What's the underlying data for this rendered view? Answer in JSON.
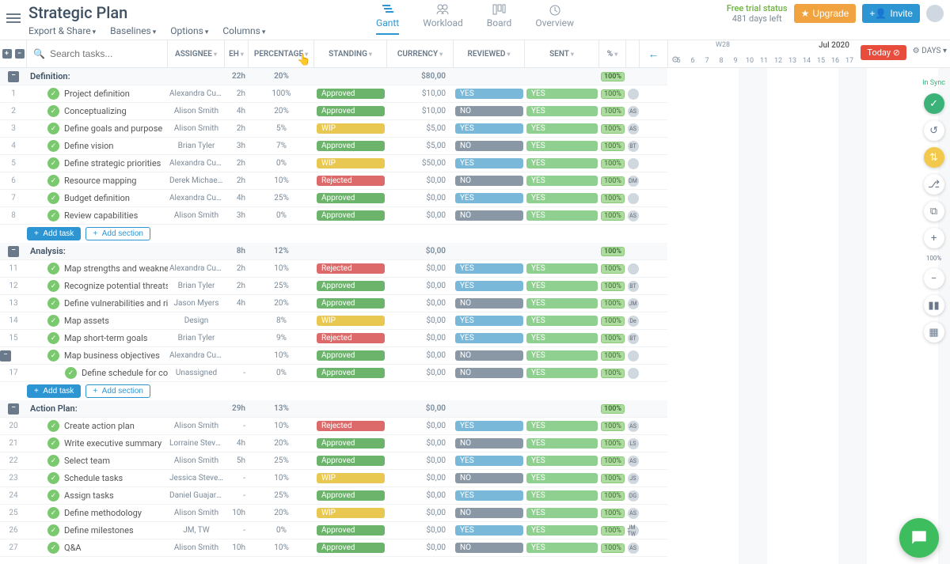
{
  "header": {
    "title": "Strategic Plan",
    "menu": [
      "Export & Share",
      "Baselines",
      "Options",
      "Columns"
    ],
    "views": [
      {
        "id": "gantt",
        "label": "Gantt",
        "active": true
      },
      {
        "id": "workload",
        "label": "Workload"
      },
      {
        "id": "board",
        "label": "Board"
      },
      {
        "id": "overview",
        "label": "Overview"
      }
    ],
    "trial_status": "Free trial status",
    "trial_days": "481 days left",
    "upgrade": "Upgrade",
    "invite": "Invite"
  },
  "toolbar": {
    "search_placeholder": "Search tasks...",
    "columns": [
      "ASSIGNEE",
      "EH",
      "PERCENTAGE",
      "STANDING",
      "CURRENCY",
      "REVIEWED",
      "SENT",
      "%"
    ],
    "back_arrow": "←"
  },
  "timeline": {
    "week_label": "W28",
    "month_label": "Jul 2020",
    "days": [
      "5",
      "6",
      "7",
      "8",
      "9",
      "10",
      "11",
      "12",
      "13",
      "14",
      "15",
      "16",
      "17"
    ],
    "today_label": "Today",
    "scale_label": "DAYS",
    "sync_label": "In Sync"
  },
  "add": {
    "task": "Add task",
    "section": "Add section"
  },
  "sections": [
    {
      "name": "Definition:",
      "summary": {
        "eh": "22h",
        "pct": "20%",
        "curr": "$80,00",
        "pctcol": "100%"
      },
      "rows": [
        {
          "n": "1",
          "name": "Project definition",
          "assignee": "Alexandra Cuart...",
          "eh": "2h",
          "pct": "100%",
          "standing": "Approved",
          "curr": "$10,00",
          "rev": "YES",
          "sent": "YES",
          "pctcol": "100%",
          "av": ""
        },
        {
          "n": "2",
          "name": "Conceptualizing",
          "assignee": "Alison Smith",
          "eh": "4h",
          "pct": "20%",
          "standing": "Approved",
          "curr": "$10,00",
          "rev": "NO",
          "sent": "YES",
          "pctcol": "100%",
          "av": "AS"
        },
        {
          "n": "3",
          "name": "Define goals and purpose",
          "assignee": "Alison Smith",
          "eh": "2h",
          "pct": "5%",
          "standing": "WIP",
          "curr": "$5,00",
          "rev": "YES",
          "sent": "YES",
          "pctcol": "100%",
          "av": "AS"
        },
        {
          "n": "4",
          "name": "Define vision",
          "assignee": "Brian Tyler",
          "eh": "3h",
          "pct": "7%",
          "standing": "Approved",
          "curr": "$5,00",
          "rev": "NO",
          "sent": "YES",
          "pctcol": "100%",
          "av": "BT"
        },
        {
          "n": "5",
          "name": "Define strategic priorities",
          "assignee": "Alexandra Cuart...",
          "eh": "2h",
          "pct": "0%",
          "standing": "WIP",
          "curr": "$50,00",
          "rev": "YES",
          "sent": "YES",
          "pctcol": "100%",
          "av": ""
        },
        {
          "n": "6",
          "name": "Resource mapping",
          "assignee": "Derek Michaels",
          "eh": "2h",
          "pct": "10%",
          "standing": "Rejected",
          "curr": "$0,00",
          "rev": "NO",
          "sent": "YES",
          "pctcol": "100%",
          "av": "DM"
        },
        {
          "n": "7",
          "name": "Budget definition",
          "assignee": "Alexandra Cuart...",
          "eh": "4h",
          "pct": "25%",
          "standing": "Approved",
          "curr": "$0,00",
          "rev": "YES",
          "sent": "YES",
          "pctcol": "100%",
          "av": ""
        },
        {
          "n": "8",
          "name": "Review capabilities",
          "assignee": "Alison Smith",
          "eh": "3h",
          "pct": "0%",
          "standing": "Approved",
          "curr": "$0,00",
          "rev": "NO",
          "sent": "YES",
          "pctcol": "100%",
          "av": "AS"
        }
      ]
    },
    {
      "name": "Analysis:",
      "summary": {
        "eh": "8h",
        "pct": "12%",
        "curr": "$0,00",
        "pctcol": "100%"
      },
      "rows": [
        {
          "n": "11",
          "name": "Map strengths and weaknes...",
          "assignee": "Alexandra Cuart...",
          "eh": "2h",
          "pct": "10%",
          "standing": "Rejected",
          "curr": "$0,00",
          "rev": "YES",
          "sent": "YES",
          "pctcol": "100%",
          "av": ""
        },
        {
          "n": "12",
          "name": "Recognize potential threats",
          "assignee": "Brian Tyler",
          "eh": "2h",
          "pct": "25%",
          "standing": "Approved",
          "curr": "$0,00",
          "rev": "YES",
          "sent": "YES",
          "pctcol": "100%",
          "av": "BT"
        },
        {
          "n": "13",
          "name": "Define vulnerabilities and ri...",
          "assignee": "Jason Myers",
          "eh": "4h",
          "pct": "20%",
          "standing": "Approved",
          "curr": "$0,00",
          "rev": "NO",
          "sent": "YES",
          "pctcol": "100%",
          "av": "JM"
        },
        {
          "n": "14",
          "name": "Map assets",
          "assignee": "Design",
          "eh": "",
          "pct": "8%",
          "standing": "WIP",
          "curr": "$0,00",
          "rev": "YES",
          "sent": "YES",
          "pctcol": "100%",
          "av": "De"
        },
        {
          "n": "15",
          "name": "Map short-term goals",
          "assignee": "Brian Tyler",
          "eh": "",
          "pct": "9%",
          "standing": "Rejected",
          "curr": "$0,00",
          "rev": "YES",
          "sent": "YES",
          "pctcol": "100%",
          "av": "BT"
        },
        {
          "n": "",
          "name": "Map business objectives",
          "assignee": "Alexandra Cuart...",
          "eh": "",
          "pct": "10%",
          "standing": "Approved",
          "curr": "$0,00",
          "rev": "NO",
          "sent": "YES",
          "pctcol": "100%",
          "av": "",
          "collapseRow": true
        },
        {
          "n": "17",
          "name": "Define schedule for co...",
          "assignee": "Unassigned",
          "eh": "-",
          "pct": "0%",
          "standing": "Approved",
          "curr": "$0,00",
          "rev": "NO",
          "sent": "YES",
          "pctcol": "100%",
          "av": "",
          "indent": 2
        }
      ]
    },
    {
      "name": "Action Plan:",
      "summary": {
        "eh": "29h",
        "pct": "13%",
        "curr": "$0,00",
        "pctcol": "100%"
      },
      "rows": [
        {
          "n": "20",
          "name": "Create action plan",
          "assignee": "Alison Smith",
          "eh": "-",
          "pct": "10%",
          "standing": "Rejected",
          "curr": "$0,00",
          "rev": "YES",
          "sent": "YES",
          "pctcol": "100%",
          "av": "AS"
        },
        {
          "n": "21",
          "name": "Write executive summary",
          "assignee": "Lorraine Stevens",
          "eh": "4h",
          "pct": "20%",
          "standing": "Approved",
          "curr": "$0,00",
          "rev": "NO",
          "sent": "YES",
          "pctcol": "100%",
          "av": "LS"
        },
        {
          "n": "22",
          "name": "Select team",
          "assignee": "Alison Smith",
          "eh": "5h",
          "pct": "25%",
          "standing": "Approved",
          "curr": "$0,00",
          "rev": "YES",
          "sent": "YES",
          "pctcol": "100%",
          "av": "AS"
        },
        {
          "n": "23",
          "name": "Schedule tasks",
          "assignee": "Jessica Stevens",
          "eh": "-",
          "pct": "10%",
          "standing": "WIP",
          "curr": "$0,00",
          "rev": "NO",
          "sent": "YES",
          "pctcol": "100%",
          "av": "JS"
        },
        {
          "n": "24",
          "name": "Assign tasks",
          "assignee": "Daniel Guajardo",
          "eh": "-",
          "pct": "25%",
          "standing": "Approved",
          "curr": "$0,00",
          "rev": "YES",
          "sent": "YES",
          "pctcol": "100%",
          "av": "DG"
        },
        {
          "n": "25",
          "name": "Define methodology",
          "assignee": "Alison Smith",
          "eh": "10h",
          "pct": "20%",
          "standing": "WIP",
          "curr": "$0,00",
          "rev": "NO",
          "sent": "YES",
          "pctcol": "100%",
          "av": "AS"
        },
        {
          "n": "26",
          "name": "Define milestones",
          "assignee": "JM, TW",
          "eh": "-",
          "pct": "0%",
          "standing": "Approved",
          "curr": "$0,00",
          "rev": "YES",
          "sent": "YES",
          "pctcol": "100%",
          "av": "JM TW"
        },
        {
          "n": "27",
          "name": "Q&A",
          "assignee": "Alison Smith",
          "eh": "10h",
          "pct": "10%",
          "standing": "Approved",
          "curr": "$0,00",
          "rev": "NO",
          "sent": "YES",
          "pctcol": "100%",
          "av": "AS"
        }
      ]
    }
  ],
  "rail": {
    "zoom": "100%"
  }
}
